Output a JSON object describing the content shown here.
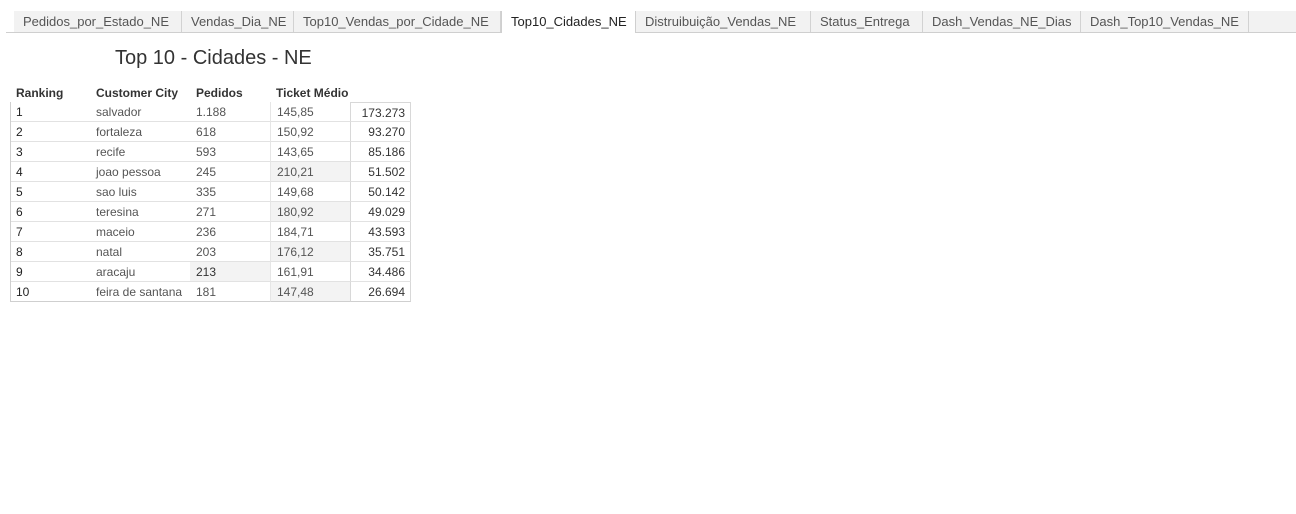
{
  "tabs": [
    {
      "label": "Pedidos_por_Estado_NE",
      "active": false
    },
    {
      "label": "Vendas_Dia_NE",
      "active": false
    },
    {
      "label": "Top10_Vendas_por_Cidade_NE",
      "active": false
    },
    {
      "label": "Top10_Cidades_NE",
      "active": true
    },
    {
      "label": "Distruibuição_Vendas_NE",
      "active": false
    },
    {
      "label": "Status_Entrega",
      "active": false
    },
    {
      "label": "Dash_Vendas_NE_Dias",
      "active": false
    },
    {
      "label": "Dash_Top10_Vendas_NE",
      "active": false
    }
  ],
  "sheet": {
    "title": "Top 10 - Cidades - NE"
  },
  "table": {
    "headers": {
      "ranking": "Ranking",
      "city": "Customer City",
      "orders": "Pedidos",
      "ticket": "Ticket Médio"
    },
    "rows": [
      {
        "ranking": "1",
        "city": "salvador",
        "orders": "1.188",
        "ticket": "145,85",
        "value": "173.273"
      },
      {
        "ranking": "2",
        "city": "fortaleza",
        "orders": "618",
        "ticket": "150,92",
        "value": "93.270"
      },
      {
        "ranking": "3",
        "city": "recife",
        "orders": "593",
        "ticket": "143,65",
        "value": "85.186"
      },
      {
        "ranking": "4",
        "city": "joao pessoa",
        "orders": "245",
        "ticket": "210,21",
        "value": "51.502"
      },
      {
        "ranking": "5",
        "city": "sao luis",
        "orders": "335",
        "ticket": "149,68",
        "value": "50.142"
      },
      {
        "ranking": "6",
        "city": "teresina",
        "orders": "271",
        "ticket": "180,92",
        "value": "49.029"
      },
      {
        "ranking": "7",
        "city": "maceio",
        "orders": "236",
        "ticket": "184,71",
        "value": "43.593"
      },
      {
        "ranking": "8",
        "city": "natal",
        "orders": "203",
        "ticket": "176,12",
        "value": "35.751"
      },
      {
        "ranking": "9",
        "city": "aracaju",
        "orders": "213",
        "ticket": "161,91",
        "value": "34.486"
      },
      {
        "ranking": "10",
        "city": "feira de santana",
        "orders": "181",
        "ticket": "147,48",
        "value": "26.694"
      }
    ]
  }
}
